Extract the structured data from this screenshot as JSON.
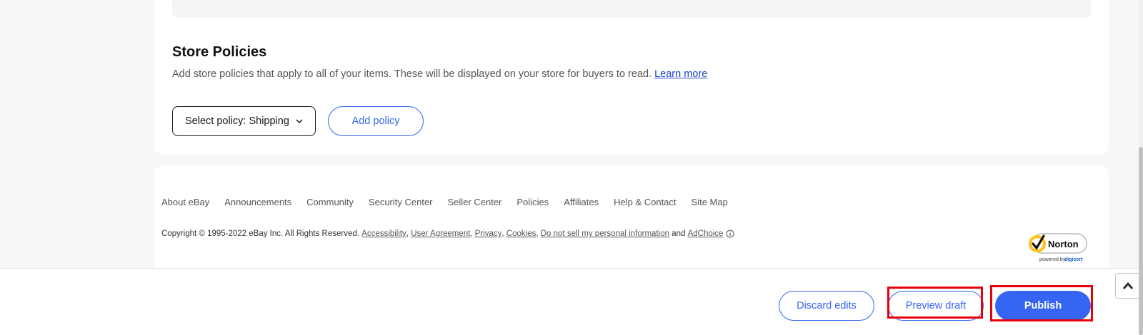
{
  "policies": {
    "title": "Store Policies",
    "description": "Add store policies that apply to all of your items. These will be displayed on your store for buyers to read.",
    "learn_more": "Learn more",
    "select_label": "Select policy: Shipping",
    "add_policy": "Add policy"
  },
  "footer": {
    "links": [
      "About eBay",
      "Announcements",
      "Community",
      "Security Center",
      "Seller Center",
      "Policies",
      "Affiliates",
      "Help & Contact",
      "Site Map"
    ],
    "copyright": "Copyright © 1995-2022 eBay Inc. All Rights Reserved.",
    "legal_links": [
      "Accessibility",
      "User Agreement",
      "Privacy",
      "Cookies",
      "Do not sell my personal information"
    ],
    "and_text": "and",
    "adchoice": "AdChoice",
    "norton": {
      "brand": "Norton",
      "powered_by": "powered by",
      "partner": "digicert"
    }
  },
  "actions": {
    "discard": "Discard edits",
    "preview": "Preview draft",
    "publish": "Publish"
  },
  "colors": {
    "accent": "#3665f3",
    "highlight": "#e8000b",
    "norton_yellow": "#ffc20e"
  }
}
